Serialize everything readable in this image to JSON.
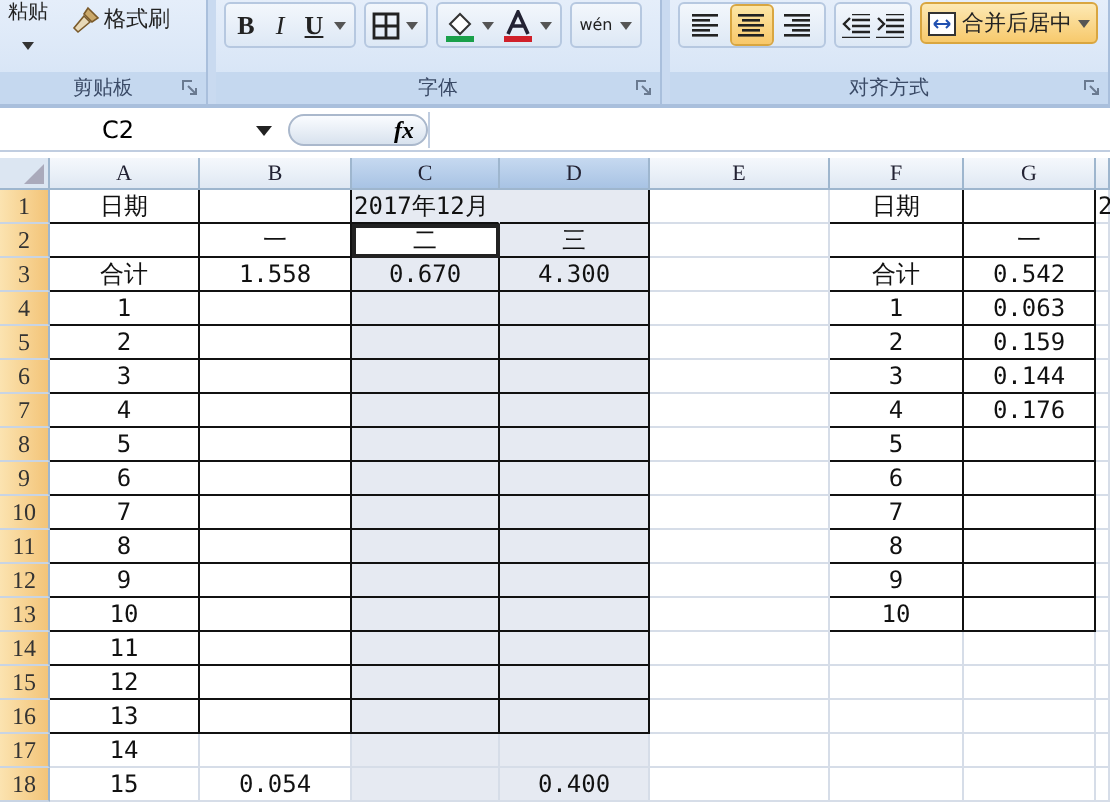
{
  "ribbon": {
    "groups": [
      {
        "kind": "clipboard",
        "label": "剪贴板",
        "paste": "粘贴",
        "painter": "格式刷"
      },
      {
        "kind": "font",
        "label": "字体",
        "bold": "B",
        "italic": "I",
        "underline": "U",
        "phonetic": "wén"
      },
      {
        "kind": "align",
        "label": "对齐方式",
        "align": [
          {
            "selected": false
          },
          {
            "selected": true
          },
          {
            "selected": false
          }
        ],
        "merge": {
          "label": "合并后居中",
          "selected": true
        }
      }
    ]
  },
  "formula_bar": {
    "name_box": "C2",
    "fx": "fx"
  },
  "columns": [
    {
      "label": "A",
      "selected": false
    },
    {
      "label": "B",
      "selected": false
    },
    {
      "label": "C",
      "selected": true
    },
    {
      "label": "D",
      "selected": true
    },
    {
      "label": "E",
      "selected": false
    },
    {
      "label": "F",
      "selected": false
    },
    {
      "label": "G",
      "selected": false
    },
    {
      "selected": false
    }
  ],
  "rows": [
    {
      "number": "1",
      "selected": true,
      "cells": [
        {
          "text": "日期"
        },
        null,
        {
          "text": "2017年12月"
        },
        null,
        null,
        {
          "text": "日期"
        },
        null,
        {
          "text": "2"
        }
      ]
    },
    {
      "number": "2",
      "selected": true,
      "cells": [
        null,
        {
          "text": "一"
        },
        {
          "text": "二",
          "active": true
        },
        {
          "text": "三"
        },
        null,
        null,
        {
          "text": "一"
        },
        null
      ]
    },
    {
      "number": "3",
      "selected": true,
      "cells": [
        {
          "text": "合计"
        },
        {
          "text": "1.558"
        },
        {
          "text": "0.670"
        },
        {
          "text": "4.300"
        },
        null,
        {
          "text": "合计"
        },
        {
          "text": "0.542"
        },
        null
      ]
    },
    {
      "number": "4",
      "selected": true,
      "cells": [
        {
          "text": "1"
        },
        null,
        null,
        null,
        null,
        {
          "text": "1"
        },
        {
          "text": "0.063"
        },
        null
      ]
    },
    {
      "number": "5",
      "selected": true,
      "cells": [
        {
          "text": "2"
        },
        null,
        null,
        null,
        null,
        {
          "text": "2"
        },
        {
          "text": "0.159"
        },
        null
      ]
    },
    {
      "number": "6",
      "selected": true,
      "cells": [
        {
          "text": "3"
        },
        null,
        null,
        null,
        null,
        {
          "text": "3"
        },
        {
          "text": "0.144"
        },
        null
      ]
    },
    {
      "number": "7",
      "selected": true,
      "cells": [
        {
          "text": "4"
        },
        null,
        null,
        null,
        null,
        {
          "text": "4"
        },
        {
          "text": "0.176"
        },
        null
      ]
    },
    {
      "number": "8",
      "selected": true,
      "cells": [
        {
          "text": "5"
        },
        null,
        null,
        null,
        null,
        {
          "text": "5"
        },
        null,
        null
      ]
    },
    {
      "number": "9",
      "selected": true,
      "cells": [
        {
          "text": "6"
        },
        null,
        null,
        null,
        null,
        {
          "text": "6"
        },
        null,
        null
      ]
    },
    {
      "number": "10",
      "selected": true,
      "cells": [
        {
          "text": "7"
        },
        null,
        null,
        null,
        null,
        {
          "text": "7"
        },
        null,
        null
      ]
    },
    {
      "number": "11",
      "selected": true,
      "cells": [
        {
          "text": "8"
        },
        null,
        null,
        null,
        null,
        {
          "text": "8"
        },
        null,
        null
      ]
    },
    {
      "number": "12",
      "selected": true,
      "cells": [
        {
          "text": "9"
        },
        null,
        null,
        null,
        null,
        {
          "text": "9"
        },
        null,
        null
      ]
    },
    {
      "number": "13",
      "selected": true,
      "cells": [
        {
          "text": "10"
        },
        null,
        null,
        null,
        null,
        {
          "text": "10"
        },
        null,
        null
      ]
    },
    {
      "number": "14",
      "selected": true,
      "cells": [
        {
          "text": "11"
        },
        null,
        null,
        null,
        null,
        null,
        null,
        null
      ]
    },
    {
      "number": "15",
      "selected": true,
      "cells": [
        {
          "text": "12"
        },
        null,
        null,
        null,
        null,
        null,
        null,
        null
      ]
    },
    {
      "number": "16",
      "selected": true,
      "cells": [
        {
          "text": "13"
        },
        null,
        null,
        null,
        null,
        null,
        null,
        null
      ]
    },
    {
      "number": "17",
      "selected": true,
      "cells": [
        {
          "text": "14"
        },
        null,
        null,
        null,
        null,
        null,
        null,
        null
      ]
    },
    {
      "number": "18",
      "selected": true,
      "cells": [
        {
          "text": "15"
        },
        {
          "text": "0.054"
        },
        null,
        {
          "text": "0.400"
        },
        null,
        null,
        null,
        null
      ]
    }
  ]
}
